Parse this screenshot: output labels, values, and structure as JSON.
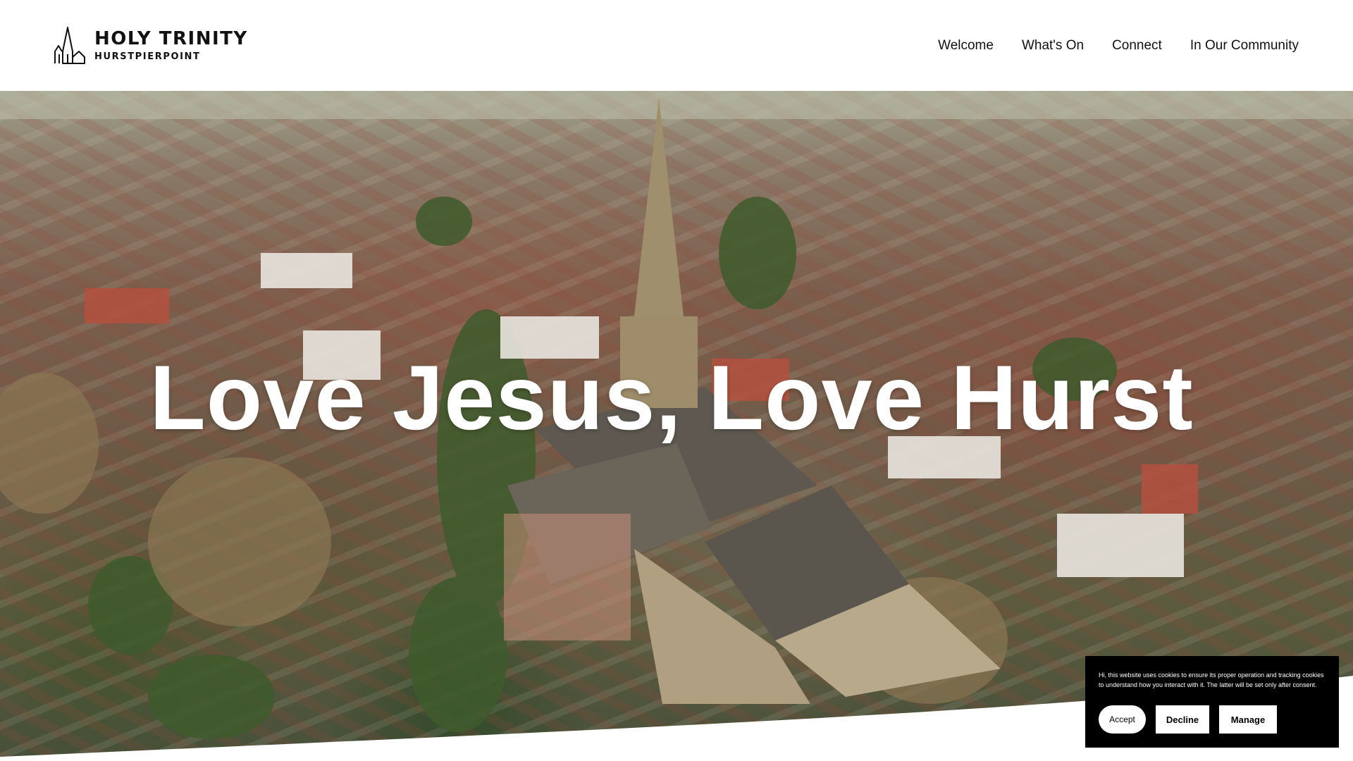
{
  "header": {
    "logo_title": "HOLY TRINITY",
    "logo_subtitle": "HURSTPIERPOINT",
    "nav": [
      {
        "label": "Welcome"
      },
      {
        "label": "What's On"
      },
      {
        "label": "Connect"
      },
      {
        "label": "In Our Community"
      }
    ]
  },
  "hero": {
    "title": "Love Jesus, Love Hurst",
    "background_icon": "aerial-village-church-photo"
  },
  "cookie_banner": {
    "text": "Hi, this website uses cookies to ensure its proper operation and tracking cookies to understand how you interact with it. The latter will be set only after consent.",
    "accept_label": "Accept",
    "decline_label": "Decline",
    "manage_label": "Manage"
  },
  "colors": {
    "header_bg": "#ffffff",
    "text_dark": "#111111",
    "hero_text": "#ffffff",
    "cookie_bg": "#000000",
    "button_bg": "#ffffff"
  }
}
